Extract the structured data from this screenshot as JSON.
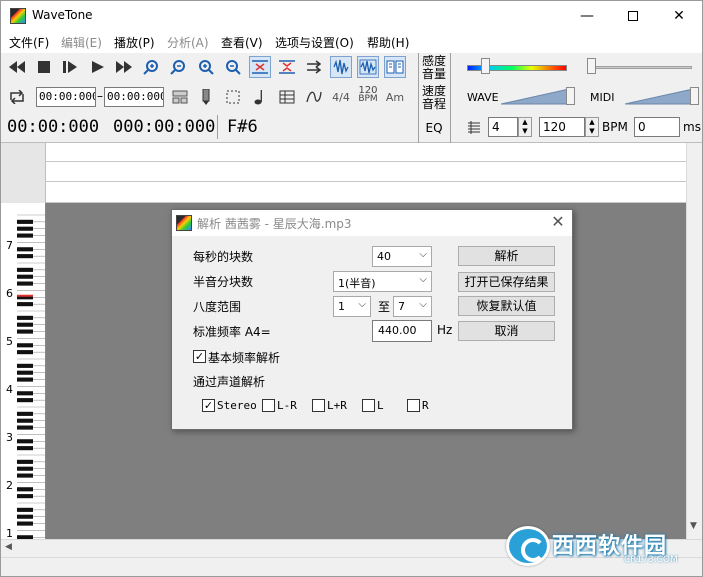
{
  "window": {
    "title": "WaveTone",
    "minimize": "—",
    "close": "✕"
  },
  "menu": [
    "文件(F)",
    "编辑(E)",
    "播放(P)",
    "分析(A)",
    "查看(V)",
    "选项与设置(O)",
    "帮助(H)"
  ],
  "menu_disabled": [
    false,
    true,
    false,
    true,
    false,
    false,
    false
  ],
  "toolbar": {
    "time_start": "00:00:000",
    "time_dash": "–",
    "time_end": "00:00:000",
    "tempo_icon_top": "120",
    "tempo_icon_bottom": "BPM",
    "timesig_icon": "4/4",
    "am_icon": "Am",
    "display_time_1": "00:00:000",
    "display_time_2": "000:00:000",
    "display_note": "F#6",
    "sensitivity_label": "感度\n音量",
    "speed_label": "速度\n音程",
    "eq_label": "EQ",
    "wave_label": "WAVE",
    "midi_label": "MIDI",
    "beats_value": "4",
    "bpm_value": "120",
    "bpm_label": "BPM",
    "ms_value": "0",
    "ms_label": "ms"
  },
  "piano_octaves": [
    "7",
    "6",
    "5",
    "4",
    "3",
    "2",
    "1"
  ],
  "dialog": {
    "title": "解析 茜茜雾 - 星辰大海.mp3",
    "close": "✕",
    "blocks_per_sec_label": "每秒的块数",
    "blocks_per_sec_value": "40",
    "semitone_label": "半音分块数",
    "semitone_value": "1(半音)",
    "octave_label": "八度范围",
    "octave_from": "1",
    "octave_to_label": "至",
    "octave_to": "7",
    "freq_label": "标准频率 A4=",
    "freq_value": "440.00",
    "freq_unit": "Hz",
    "base_freq_label": "基本频率解析",
    "base_freq_checked": true,
    "channel_label": "通过声道解析",
    "channels": [
      {
        "label": "Stereo",
        "checked": true
      },
      {
        "label": "L-R",
        "checked": false
      },
      {
        "label": "L+R",
        "checked": false
      },
      {
        "label": "L",
        "checked": false
      },
      {
        "label": "R",
        "checked": false
      }
    ],
    "btn_analyze": "解析",
    "btn_open_saved": "打开已保存结果",
    "btn_restore_default": "恢复默认值",
    "btn_cancel": "取消"
  },
  "watermark": {
    "text": "西西软件园",
    "sub": "CR173.COM"
  },
  "colors": {
    "piano_marker": "#e53030",
    "roll_background": "#7f7f7f",
    "meter_gradient": "blue-green-yellow-red"
  }
}
